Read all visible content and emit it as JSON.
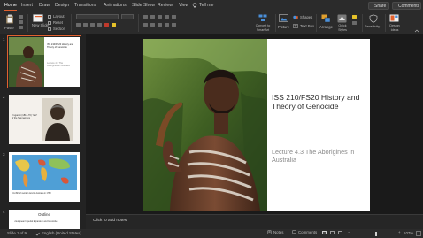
{
  "menu": {
    "tabs": [
      {
        "label": "Home",
        "active": true
      },
      {
        "label": "Insert",
        "active": false
      },
      {
        "label": "Draw",
        "active": false
      },
      {
        "label": "Design",
        "active": false
      },
      {
        "label": "Transitions",
        "active": false
      },
      {
        "label": "Animations",
        "active": false
      },
      {
        "label": "Slide Show",
        "active": false
      },
      {
        "label": "Review",
        "active": false
      },
      {
        "label": "View",
        "active": false
      }
    ],
    "tell_me": "Tell me",
    "share": "Share",
    "comments": "Comments"
  },
  "ribbon": {
    "paste": "Paste",
    "new_slide": "New Slide",
    "layout": "Layout",
    "reset": "Reset",
    "section": "Section",
    "convert_to_smartart": "Convert to SmartArt",
    "picture": "Picture",
    "shapes": "Shapes",
    "text_box": "Text Box",
    "arrange": "Arrange",
    "quick_styles": "Quick Styles",
    "sensitivity": "Sensitivity",
    "design_ideas": "Design Ideas"
  },
  "thumbnails": [
    {
      "number": "1",
      "title": "ISS 210/FS20 History and Theory of Genocide",
      "subtitle": "Lecture 4.3 The Aborigines in Australia"
    },
    {
      "number": "2",
      "caption": "Truganini (1812-76) “last” of the Tasmanians"
    },
    {
      "number": "3",
      "caption": "First British settlers land in Australia in 1788"
    },
    {
      "number": "4",
      "title": "Outline",
      "bullet": "• European Imperial Expansion and Genocide"
    }
  ],
  "slide": {
    "title": "ISS 210/FS20 History and Theory of Genocide",
    "subtitle": "Lecture 4.3 The Aborigines in Australia"
  },
  "notes_placeholder": "Click to add notes",
  "status": {
    "slide_counter": "Slide 1 of 9",
    "language": "English (United States)",
    "notes": "Notes",
    "comments": "Comments",
    "zoom": "107%",
    "zoom_level": 0.55
  },
  "colors": {
    "accent": "#e0612f",
    "background": "#1f1f1f",
    "ribbon": "#2b2b2b"
  }
}
